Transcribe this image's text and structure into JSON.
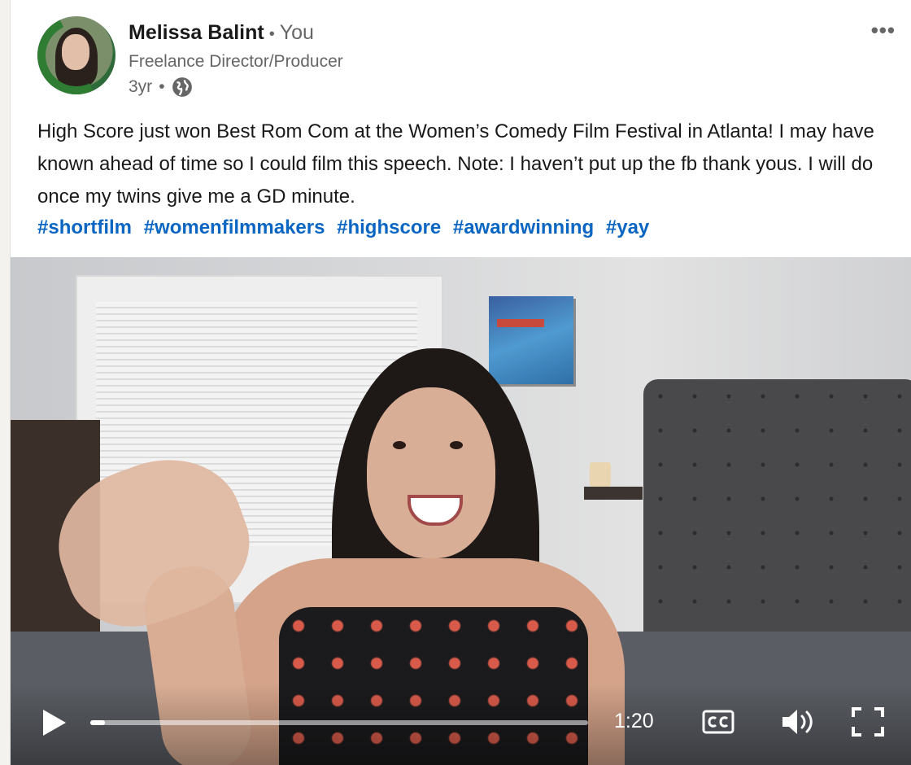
{
  "post": {
    "author": {
      "name": "Melissa Balint",
      "relation": "You",
      "headline": "Freelance Director/Producer",
      "time": "3yr",
      "visibility_icon": "globe-icon",
      "avatar_badge": "#OPENTOWORK"
    },
    "more_icon": "more-horizontal-icon",
    "text": "High Score just won Best Rom Com at the Women’s Comedy Film Festival in Atlanta! I may have known ahead of time so I could film this speech. Note: I haven’t put up the fb thank yous. I will do once my twins give me a GD minute.",
    "hashtags": [
      "#shortfilm",
      "#womenfilmmakers",
      "#highscore",
      "#awardwinning",
      "#yay"
    ]
  },
  "video": {
    "duration": "1:20",
    "progress_fraction": 0.03,
    "controls": {
      "play_icon": "play-icon",
      "cc_icon": "closed-captions-icon",
      "volume_icon": "volume-icon",
      "fullscreen_icon": "fullscreen-icon"
    }
  },
  "colors": {
    "hashtag": "#0a66c2",
    "text": "#191919",
    "muted": "#666666",
    "badge_green": "#2e7d32"
  }
}
